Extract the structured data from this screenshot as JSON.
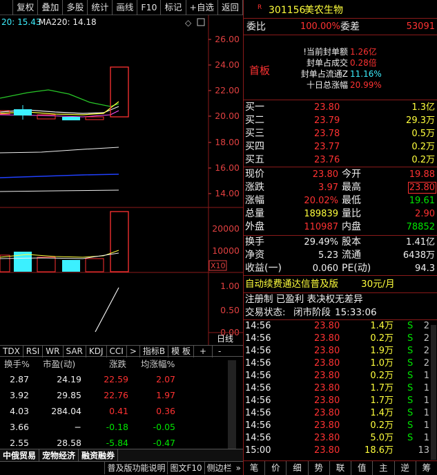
{
  "toolbar": {
    "items": [
      "复权",
      "叠加",
      "多股",
      "统计",
      "画线",
      "F10",
      "标记",
      "+自选",
      "返回"
    ]
  },
  "chart": {
    "ma_label": "MA220: 14.18",
    "ma_prev_value": "20: 15.43",
    "price_axis": [
      "26.00",
      "24.00",
      "22.00",
      "20.00",
      "18.00",
      "16.00",
      "14.00"
    ],
    "volume_axis": [
      "20000",
      "10000"
    ],
    "volume_unit": "X10",
    "indicator_axis": [
      "1.00",
      "0.50",
      "0.00"
    ],
    "period": "日线"
  },
  "indicator_tabs": [
    "TDX",
    "RSI",
    "WR",
    "SAR",
    "KDJ",
    "CCI",
    ">",
    "指标B",
    "模 板",
    "+",
    "-"
  ],
  "table": {
    "headers": [
      "换手%",
      "市盈(动)",
      "涨跌",
      "均涨幅%"
    ],
    "rows": [
      {
        "turnover": "2.87",
        "pe": "24.19",
        "change": "22.59",
        "avg": "2.07",
        "dir": "up"
      },
      {
        "turnover": "3.92",
        "pe": "29.85",
        "change": "22.76",
        "avg": "1.97",
        "dir": "up"
      },
      {
        "turnover": "4.03",
        "pe": "284.04",
        "change": "0.41",
        "avg": "0.36",
        "dir": "up"
      },
      {
        "turnover": "3.66",
        "pe": "−",
        "change": "-0.18",
        "avg": "-0.05",
        "dir": "down"
      },
      {
        "turnover": "2.55",
        "pe": "28.58",
        "change": "-5.84",
        "avg": "-0.47",
        "dir": "down"
      }
    ],
    "sector_tabs": [
      "中俄贸易",
      "宠物经济",
      "融资融券"
    ]
  },
  "bottom_left": [
    "普及版功能说明",
    "图文F10",
    "侧边栏",
    "»"
  ],
  "stock": {
    "marker": "R",
    "code": "301156",
    "name": "美农生物"
  },
  "weibi": {
    "label": "委比",
    "ratio": "100.00%",
    "diff_label": "委差",
    "diff": "53091"
  },
  "seal": {
    "board": "首板",
    "lines": [
      {
        "label": "!当前封单额",
        "value": "1.26亿"
      },
      {
        "label": "封单占成交",
        "value": "0.28倍"
      },
      {
        "label": "封单占流通Z",
        "value": "11.16%"
      },
      {
        "label": "十日总涨幅",
        "value": "20.99%"
      }
    ]
  },
  "bids": [
    {
      "label": "买一",
      "price": "23.80",
      "vol": "1.3亿"
    },
    {
      "label": "买二",
      "price": "23.79",
      "vol": "29.3万"
    },
    {
      "label": "买三",
      "price": "23.78",
      "vol": "0.5万"
    },
    {
      "label": "买四",
      "price": "23.77",
      "vol": "0.2万"
    },
    {
      "label": "买五",
      "price": "23.76",
      "vol": "0.2万"
    }
  ],
  "quote": [
    {
      "l1": "现价",
      "v1": "23.80",
      "l2": "今开",
      "v2": "19.88"
    },
    {
      "l1": "涨跌",
      "v1": "3.97",
      "l2": "最高",
      "v2": "23.80"
    },
    {
      "l1": "涨幅",
      "v1": "20.02%",
      "l2": "最低",
      "v2": "19.61"
    },
    {
      "l1": "总量",
      "v1": "189839",
      "l2": "量比",
      "v2": "2.90"
    },
    {
      "l1": "外盘",
      "v1": "110987",
      "l2": "内盘",
      "v2": "78852"
    }
  ],
  "stats": [
    {
      "l1": "换手",
      "v1": "29.49%",
      "l2": "股本",
      "v2": "1.41亿"
    },
    {
      "l1": "净资",
      "v1": "5.23",
      "l2": "流通",
      "v2": "6438万"
    },
    {
      "l1": "收益(一)",
      "v1": "0.060",
      "l2": "PE(动)",
      "v2": "94.3"
    }
  ],
  "promo": {
    "text": "自动续费通达信普及版",
    "price": "30元/月"
  },
  "company_tags": "注册制 已盈利 表决权无差异",
  "trade_status": {
    "label": "交易状态:",
    "value": "闭市阶段",
    "time": "15:33:06"
  },
  "ticks": [
    {
      "time": "14:56",
      "price": "23.80",
      "vol": "1.4万",
      "side": "S",
      "n": "2"
    },
    {
      "time": "14:56",
      "price": "23.80",
      "vol": "0.2万",
      "side": "S",
      "n": "2"
    },
    {
      "time": "14:56",
      "price": "23.80",
      "vol": "1.9万",
      "side": "S",
      "n": "2"
    },
    {
      "time": "14:56",
      "price": "23.80",
      "vol": "1.0万",
      "side": "S",
      "n": "2"
    },
    {
      "time": "14:56",
      "price": "23.80",
      "vol": "0.2万",
      "side": "S",
      "n": "1"
    },
    {
      "time": "14:56",
      "price": "23.80",
      "vol": "1.7万",
      "side": "S",
      "n": "1"
    },
    {
      "time": "14:56",
      "price": "23.80",
      "vol": "1.7万",
      "side": "S",
      "n": "1"
    },
    {
      "time": "14:56",
      "price": "23.80",
      "vol": "1.4万",
      "side": "S",
      "n": "1"
    },
    {
      "time": "14:56",
      "price": "23.80",
      "vol": "0.2万",
      "side": "S",
      "n": "1"
    },
    {
      "time": "14:56",
      "price": "23.80",
      "vol": "5.0万",
      "side": "S",
      "n": "1"
    },
    {
      "time": "15:00",
      "price": "23.80",
      "vol": "18.6万",
      "side": "",
      "n": "13"
    }
  ],
  "bottom_right": [
    "笔",
    "价",
    "细",
    "势",
    "联",
    "值",
    "主",
    "逆",
    "筹"
  ]
}
